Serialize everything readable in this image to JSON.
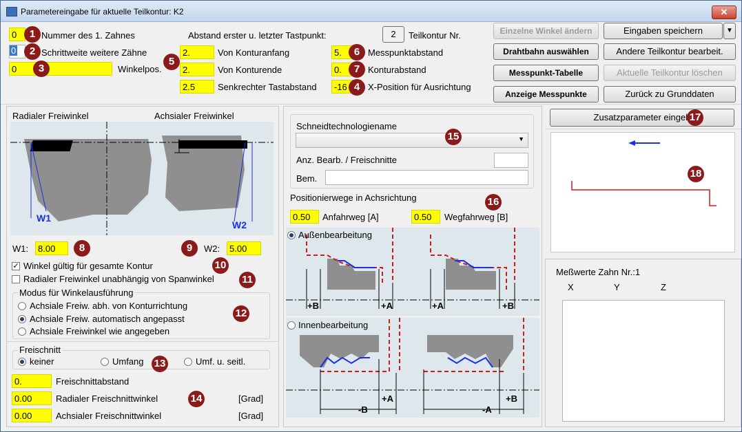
{
  "window": {
    "title": "Parametereingabe für aktuelle Teilkontur: K2",
    "close_glyph": "✕"
  },
  "top": {
    "zahn_nr_value": "0",
    "zahn_nr_label": "Nummer des 1. Zahnes",
    "schrittweite_value": "0",
    "schrittweite_label": "Schrittweite weitere Zähne",
    "winkelpos_value": "0",
    "winkelpos_label": "Winkelpos.",
    "abstand_title": "Abstand erster u. letzter Tastpunkt:",
    "teilkontur_value": "2",
    "teilkontur_label": "Teilkontur Nr.",
    "von_konturanfang_value": "2.",
    "von_konturanfang_label": "Von Konturanfang",
    "von_konturende_value": "2.",
    "von_konturende_label": "Von Konturende",
    "senkrechter_value": "2.5",
    "senkrechter_label": "Senkrechter Tastabstand",
    "messpunktabstand_value": "5.",
    "messpunktabstand_label": "Messpunktabstand",
    "konturabstand_value": "0.",
    "konturabstand_label": "Konturabstand",
    "xpos_value": "-16",
    "xpos_label": "X-Position für Ausrichtung"
  },
  "buttons": {
    "einzelne_winkel": "Einzelne Winkel ändern",
    "eingaben_speichern": "Eingaben speichern",
    "drahtbahn": "Drahtbahn auswählen",
    "andere_teilkontur": "Andere Teilkontur bearbeit.",
    "messpunkt_tabelle": "Messpunkt-Tabelle",
    "aktuelle_loeschen": "Aktuelle Teilkontur löschen",
    "anzeige_messpunkte": "Anzeige Messpunkte",
    "zurueck": "Zurück zu Grunddaten",
    "zusatzparameter": "Zusatzparameter eingeb",
    "dropdown_glyph": "▼"
  },
  "badges": [
    "1",
    "2",
    "3",
    "4",
    "5",
    "6",
    "7",
    "8",
    "9",
    "10",
    "11",
    "12",
    "13",
    "14",
    "15",
    "16",
    "17",
    "18"
  ],
  "left": {
    "radialer_label": "Radialer Freiwinkel",
    "achsialer_label": "Achsialer Freiwinkel",
    "w1_img": "W1",
    "w2_img": "W2",
    "w1_label": "W1:",
    "w1_value": "8.00",
    "w2_label": "W2:",
    "w2_value": "5.00",
    "chk_winkel_label": "Winkel gültig für gesamte Kontur",
    "chk_winkel_checked": "✓",
    "chk_radial_label": "Radialer Freiwinkel unabhängig von Spanwinkel",
    "modus_title": "Modus für Winkelausführung",
    "modus_options": [
      "Achsiale Freiw. abh. von Konturrichtung",
      "Achsiale Freiw. automatisch angepasst",
      "Achsiale Freiwinkel wie angegeben"
    ],
    "freischnitt_title": "Freischnitt",
    "freischnitt_options": [
      "keiner",
      "Umfang",
      "Umf. u. seitl."
    ],
    "freischnittabstand_value": "0.",
    "freischnittabstand_label": "Freischnittabstand",
    "radial_fs_value": "0.00",
    "radial_fs_label": "Radialer Freischnittwinkel",
    "radial_fs_unit": "[Grad]",
    "achsial_fs_value": "0.00",
    "achsial_fs_label": "Achsialer Freischnittwinkel",
    "achsial_fs_unit": "[Grad]"
  },
  "middle": {
    "schneidtech_label": "Schneidtechnologiename",
    "anz_label": "Anz. Bearb. / Freischnitte",
    "bem_label": "Bem.",
    "positionier_label": "Positionierwege in Achsrichtung",
    "anfahrweg_value": "0.50",
    "anfahrweg_label": "Anfahrweg [A]",
    "wegfahrweg_value": "0.50",
    "wegfahrweg_label": "Wegfahrweg [B]",
    "aussen_label": "Außenbearbeitung",
    "innen_label": "Innenbearbeitung",
    "dim_plus_b": "+B",
    "dim_plus_a": "+A",
    "dim_minus_b": "-B",
    "dim_minus_a": "-A"
  },
  "right": {
    "messwerte_label": "Meßwerte Zahn Nr.:1",
    "col_x": "X",
    "col_y": "Y",
    "col_z": "Z"
  },
  "colors": {
    "highlight": "#ffff00",
    "badge": "#8b1a1a",
    "arrow_blue": "#1a2fe0",
    "contour_red": "#d01a1a"
  }
}
